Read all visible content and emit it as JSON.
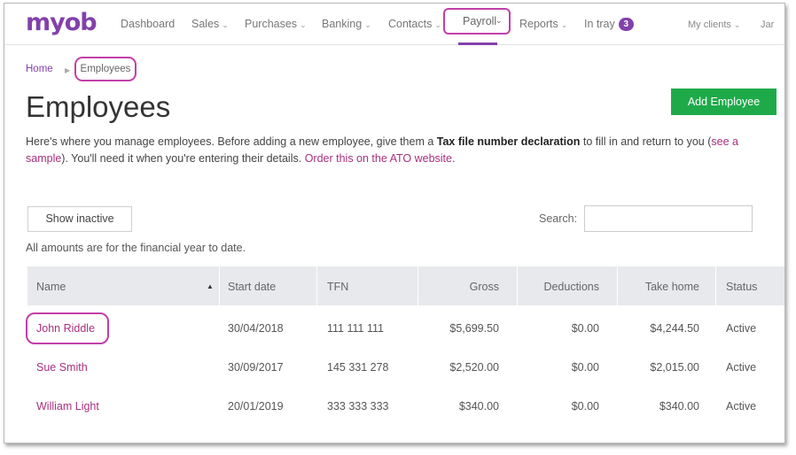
{
  "nav": {
    "logo": "myob",
    "items": [
      {
        "label": "Dashboard"
      },
      {
        "label": "Sales",
        "caret": "⌄"
      },
      {
        "label": "Purchases",
        "caret": "⌄"
      },
      {
        "label": "Banking",
        "caret": "⌄"
      },
      {
        "label": "Contacts",
        "caret": "⌄"
      },
      {
        "label": "Payroll",
        "caret": "⌄"
      },
      {
        "label": "Reports",
        "caret": "⌄"
      },
      {
        "label": "In tray",
        "badge": "3"
      }
    ],
    "my_clients": "My clients",
    "my_clients_caret": "⌄",
    "user_partial": "Jar"
  },
  "breadcrumb": {
    "home": "Home",
    "separator": "▶",
    "current": "Employees"
  },
  "page": {
    "title": "Employees",
    "add_button": "Add Employee",
    "intro": {
      "part1": "Here's where you manage employees. Before adding a new employee, give them a ",
      "bold": "Tax file number declaration",
      "part2": " to fill in and return to you (",
      "link1": "see a sample",
      "part3": "). You'll need it when you're entering their details. ",
      "link2": "Order this on the ATO website",
      "part4": "."
    },
    "show_inactive": "Show inactive",
    "search_label": "Search:",
    "search_value": "",
    "amounts_note": "All amounts are for the financial year to date."
  },
  "table": {
    "columns": [
      "Name",
      "Start date",
      "TFN",
      "Gross",
      "Deductions",
      "Take home",
      "Status"
    ],
    "sort_indicator": "▲",
    "rows": [
      {
        "name": "John Riddle",
        "start": "30/04/2018",
        "tfn": "111 111 111",
        "gross": "$5,699.50",
        "deductions": "$0.00",
        "take_home": "$4,244.50",
        "status": "Active"
      },
      {
        "name": "Sue Smith",
        "start": "30/09/2017",
        "tfn": "145 331 278",
        "gross": "$2,520.00",
        "deductions": "$0.00",
        "take_home": "$2,015.00",
        "status": "Active"
      },
      {
        "name": "William Light",
        "start": "20/01/2019",
        "tfn": "333 333 333",
        "gross": "$340.00",
        "deductions": "$0.00",
        "take_home": "$340.00",
        "status": "Active"
      }
    ]
  },
  "colors": {
    "brand": "#8241aa",
    "link": "#a8307e",
    "highlight_ring": "#c23fa8",
    "add_button": "#1faa4a",
    "table_header": "#e7e9ec"
  }
}
